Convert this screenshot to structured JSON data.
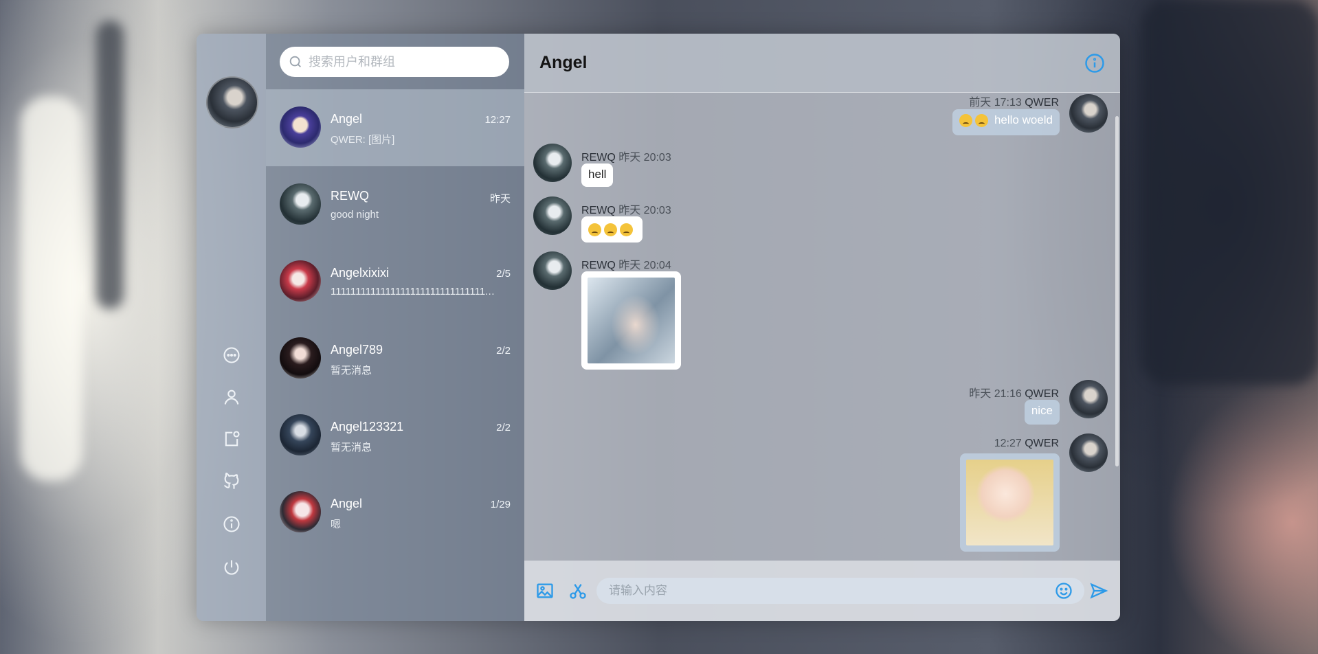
{
  "colors": {
    "accent": "#2d9ae8",
    "nav_bg": "#a0acbc",
    "list_bg": "#7a8698",
    "bubble_left": "#ffffff"
  },
  "search": {
    "placeholder": "搜索用户和群组"
  },
  "nav": {
    "icons": [
      "chat-icon",
      "user-icon",
      "add-group-icon",
      "github-icon",
      "info-icon",
      "power-icon"
    ]
  },
  "conversations": [
    {
      "name": "Angel",
      "time": "12:27",
      "last": "QWER: [图片]"
    },
    {
      "name": "REWQ",
      "time": "昨天",
      "last": "good night"
    },
    {
      "name": "Angelxixixi",
      "time": "2/5",
      "last": "1111111111111111111111111111111111"
    },
    {
      "name": "Angel789",
      "time": "2/2",
      "last": "暂无消息"
    },
    {
      "name": "Angel123321",
      "time": "2/2",
      "last": "暂无消息"
    },
    {
      "name": "Angel",
      "time": "1/29",
      "last": "嗯"
    }
  ],
  "chat": {
    "title": "Angel",
    "messages": [
      {
        "time": "前天 17:13",
        "user": "QWER",
        "text": "hello woeld"
      },
      {
        "time": "昨天 20:03",
        "user": "REWQ",
        "text": "hell"
      },
      {
        "time": "昨天 20:03",
        "user": "REWQ",
        "text": ""
      },
      {
        "time": "昨天 20:04",
        "user": "REWQ",
        "text": ""
      },
      {
        "time": "昨天 21:16",
        "user": "QWER",
        "text": "nice"
      },
      {
        "time": "12:27",
        "user": "QWER",
        "text": ""
      }
    ]
  },
  "composer": {
    "placeholder": "请输入内容"
  }
}
